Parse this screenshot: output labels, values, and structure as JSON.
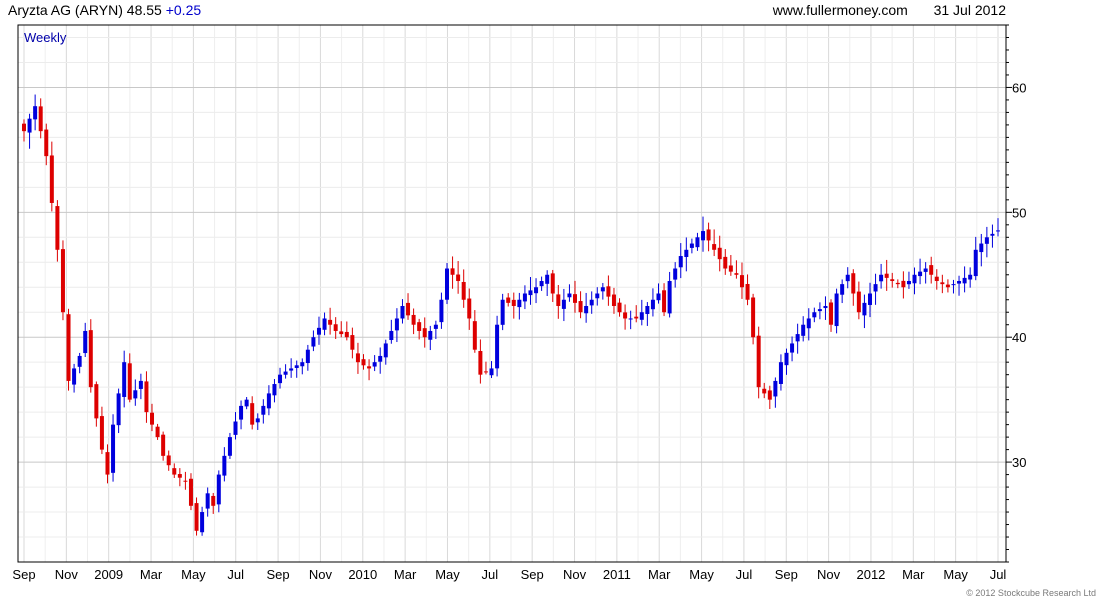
{
  "header": {
    "instrument": "Aryzta AG (ARYN)",
    "last": "48.55",
    "change": "+0.25",
    "site": "www.fullermoney.com",
    "date": "31 Jul 2012"
  },
  "copyright": "© 2012 Stockcube Research Ltd",
  "colors": {
    "up": "#0000dd",
    "down": "#dd0000",
    "grid": "#d9d9d9",
    "frame": "#000000",
    "period_label": "#0000aa"
  },
  "chart_data": {
    "type": "candlestick",
    "period_label": "Weekly",
    "y_ticks": [
      30,
      40,
      50,
      60
    ],
    "ylim": [
      22,
      65
    ],
    "y_axis_side": "right",
    "grid": true,
    "x_labels": [
      "Sep",
      "Nov",
      "2009",
      "Mar",
      "May",
      "Jul",
      "Sep",
      "Nov",
      "2010",
      "Mar",
      "May",
      "Jul",
      "Sep",
      "Nov",
      "2011",
      "Mar",
      "May",
      "Jul",
      "Sep",
      "Nov",
      "2012",
      "Mar",
      "May",
      "Jul"
    ],
    "anchors": [
      [
        0,
        56.5
      ],
      [
        2,
        58.5
      ],
      [
        4,
        54.5
      ],
      [
        6,
        47
      ],
      [
        7,
        42
      ],
      [
        8,
        36.5
      ],
      [
        10,
        38.5
      ],
      [
        11,
        40.5
      ],
      [
        12,
        36
      ],
      [
        14,
        31
      ],
      [
        15,
        29
      ],
      [
        16,
        33
      ],
      [
        18,
        38
      ],
      [
        19,
        35
      ],
      [
        21,
        36.5
      ],
      [
        22,
        34
      ],
      [
        24,
        32
      ],
      [
        25,
        30.5
      ],
      [
        27,
        29
      ],
      [
        29,
        28.5
      ],
      [
        30,
        26.5
      ],
      [
        31,
        24.5
      ],
      [
        32,
        26
      ],
      [
        33,
        27.5
      ],
      [
        34,
        26.5
      ],
      [
        35,
        29
      ],
      [
        37,
        32
      ],
      [
        39,
        34.5
      ],
      [
        40,
        35
      ],
      [
        41,
        33
      ],
      [
        42,
        33.5
      ],
      [
        43,
        34.5
      ],
      [
        44,
        35.5
      ],
      [
        46,
        37
      ],
      [
        48,
        37.5
      ],
      [
        50,
        38
      ],
      [
        52,
        40
      ],
      [
        54,
        41.5
      ],
      [
        56,
        40.5
      ],
      [
        58,
        40
      ],
      [
        59,
        39
      ],
      [
        60,
        38
      ],
      [
        62,
        37.5
      ],
      [
        64,
        38.5
      ],
      [
        66,
        40.5
      ],
      [
        68,
        42.5
      ],
      [
        70,
        41
      ],
      [
        72,
        40
      ],
      [
        74,
        41
      ],
      [
        75,
        43
      ],
      [
        76,
        45.5
      ],
      [
        78,
        44.5
      ],
      [
        80,
        41.5
      ],
      [
        81,
        39
      ],
      [
        82,
        37
      ],
      [
        84,
        37.5
      ],
      [
        85,
        41
      ],
      [
        86,
        43
      ],
      [
        88,
        42.5
      ],
      [
        90,
        43.5
      ],
      [
        92,
        44
      ],
      [
        94,
        45
      ],
      [
        95,
        43.5
      ],
      [
        96,
        42.5
      ],
      [
        98,
        43.5
      ],
      [
        100,
        42
      ],
      [
        102,
        43
      ],
      [
        104,
        44
      ],
      [
        106,
        42.5
      ],
      [
        108,
        41.5
      ],
      [
        110,
        41.5
      ],
      [
        112,
        42.5
      ],
      [
        114,
        43.5
      ],
      [
        115,
        42
      ],
      [
        116,
        44.5
      ],
      [
        118,
        46.5
      ],
      [
        120,
        47.5
      ],
      [
        122,
        48.5
      ],
      [
        124,
        47
      ],
      [
        126,
        45.5
      ],
      [
        128,
        45
      ],
      [
        130,
        43
      ],
      [
        131,
        40
      ],
      [
        132,
        36
      ],
      [
        134,
        35
      ],
      [
        136,
        38
      ],
      [
        138,
        39.5
      ],
      [
        140,
        41
      ],
      [
        142,
        42
      ],
      [
        144,
        42.5
      ],
      [
        145,
        41
      ],
      [
        146,
        43.5
      ],
      [
        148,
        45
      ],
      [
        149,
        43.5
      ],
      [
        150,
        42
      ],
      [
        152,
        43.5
      ],
      [
        154,
        45
      ],
      [
        156,
        44.5
      ],
      [
        158,
        44
      ],
      [
        160,
        45
      ],
      [
        162,
        45.5
      ],
      [
        164,
        44.5
      ],
      [
        166,
        44
      ],
      [
        168,
        44.5
      ],
      [
        170,
        45
      ],
      [
        171,
        47
      ],
      [
        173,
        48
      ],
      [
        175,
        48.55
      ]
    ]
  }
}
